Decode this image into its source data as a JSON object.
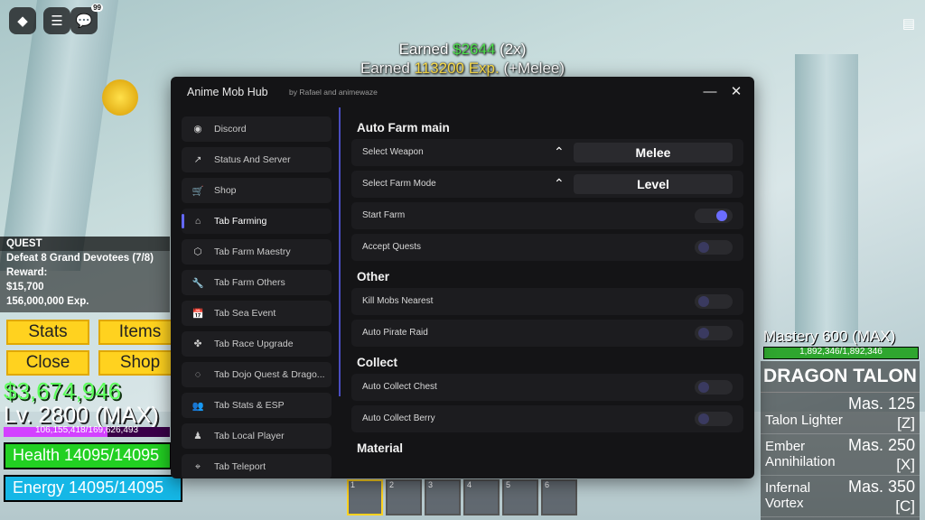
{
  "top_bar": {
    "chat_badge": "99"
  },
  "earned": {
    "line1_prefix": "Earned ",
    "line1_money": "$2644",
    "line1_suffix": " (2x)",
    "line2_prefix": "Earned ",
    "line2_exp": "113200 Exp.",
    "line2_suffix": " (+Melee)"
  },
  "panel": {
    "title": "Anime Mob Hub",
    "subtitle": "by Rafael and animewaze",
    "minimize": "—",
    "close": "✕",
    "sidebar": [
      {
        "label": "Discord",
        "icon": "discord-icon",
        "glyph": "◉"
      },
      {
        "label": "Status And Server",
        "icon": "chart-icon",
        "glyph": "↗"
      },
      {
        "label": "Shop",
        "icon": "cart-icon",
        "glyph": "🛒"
      },
      {
        "label": "Tab Farming",
        "icon": "home-icon",
        "glyph": "⌂",
        "active": true
      },
      {
        "label": "Tab Farm Maestry",
        "icon": "box-icon",
        "glyph": "⬡"
      },
      {
        "label": "Tab Farm Others",
        "icon": "wrench-icon",
        "glyph": "🔧"
      },
      {
        "label": "Tab Sea Event",
        "icon": "calendar-icon",
        "glyph": "📅"
      },
      {
        "label": "Tab Race Upgrade",
        "icon": "sprout-icon",
        "glyph": "✤"
      },
      {
        "label": "Tab Dojo Quest & Drago...",
        "icon": "chat-icon",
        "glyph": "◌"
      },
      {
        "label": "Tab Stats & ESP",
        "icon": "users-icon",
        "glyph": "👥"
      },
      {
        "label": "Tab Local Player",
        "icon": "person-icon",
        "glyph": "♟"
      },
      {
        "label": "Tab Teleport",
        "icon": "pin-icon",
        "glyph": "⌖"
      }
    ],
    "sections": {
      "auto_farm_main": "Auto Farm main",
      "other": "Other",
      "collect": "Collect",
      "material": "Material"
    },
    "select_weapon": {
      "label": "Select Weapon",
      "value": "Melee"
    },
    "select_farm_mode": {
      "label": "Select Farm Mode",
      "value": "Level"
    },
    "toggles": {
      "start_farm": {
        "label": "Start Farm",
        "on": true
      },
      "accept_quests": {
        "label": "Accept Quests",
        "on": false
      },
      "kill_mobs_nearest": {
        "label": "Kill Mobs Nearest",
        "on": false
      },
      "auto_pirate_raid": {
        "label": "Auto Pirate Raid",
        "on": false
      },
      "auto_collect_chest": {
        "label": "Auto Collect Chest",
        "on": false
      },
      "auto_collect_berry": {
        "label": "Auto Collect Berry",
        "on": false
      }
    },
    "accent_color": "#6b6dff"
  },
  "hud": {
    "quest_header": "QUEST",
    "quest_text": "Defeat 8 Grand Devotees (7/8)",
    "reward_label": "Reward:",
    "reward_money": "$15,700",
    "reward_exp": "156,000,000 Exp.",
    "buttons": {
      "stats": "Stats",
      "items": "Items",
      "close": "Close",
      "shop": "Shop"
    },
    "money": "$3,674,946",
    "level": "Lv. 2800 (MAX)",
    "xp_text": "106,155,418/169,626,493",
    "xp_fraction": 0.626,
    "health_text": "Health 14095/14095",
    "energy_text": "Energy 14095/14095",
    "mastery": "Mastery 600 (MAX)",
    "mastery_text": "1,892,346/1,892,346",
    "weapon_name": "DRAGON TALON",
    "skills": [
      {
        "name": "Talon Lighter",
        "mastery": "Mas. 125",
        "key": "[Z]"
      },
      {
        "name": "Ember Annihilation",
        "mastery": "Mas. 250",
        "key": "[X]"
      },
      {
        "name": "Infernal Vortex",
        "mastery": "Mas. 350",
        "key": "[C]"
      }
    ],
    "hotbar": [
      "1",
      "2",
      "3",
      "4",
      "5",
      "6"
    ]
  }
}
